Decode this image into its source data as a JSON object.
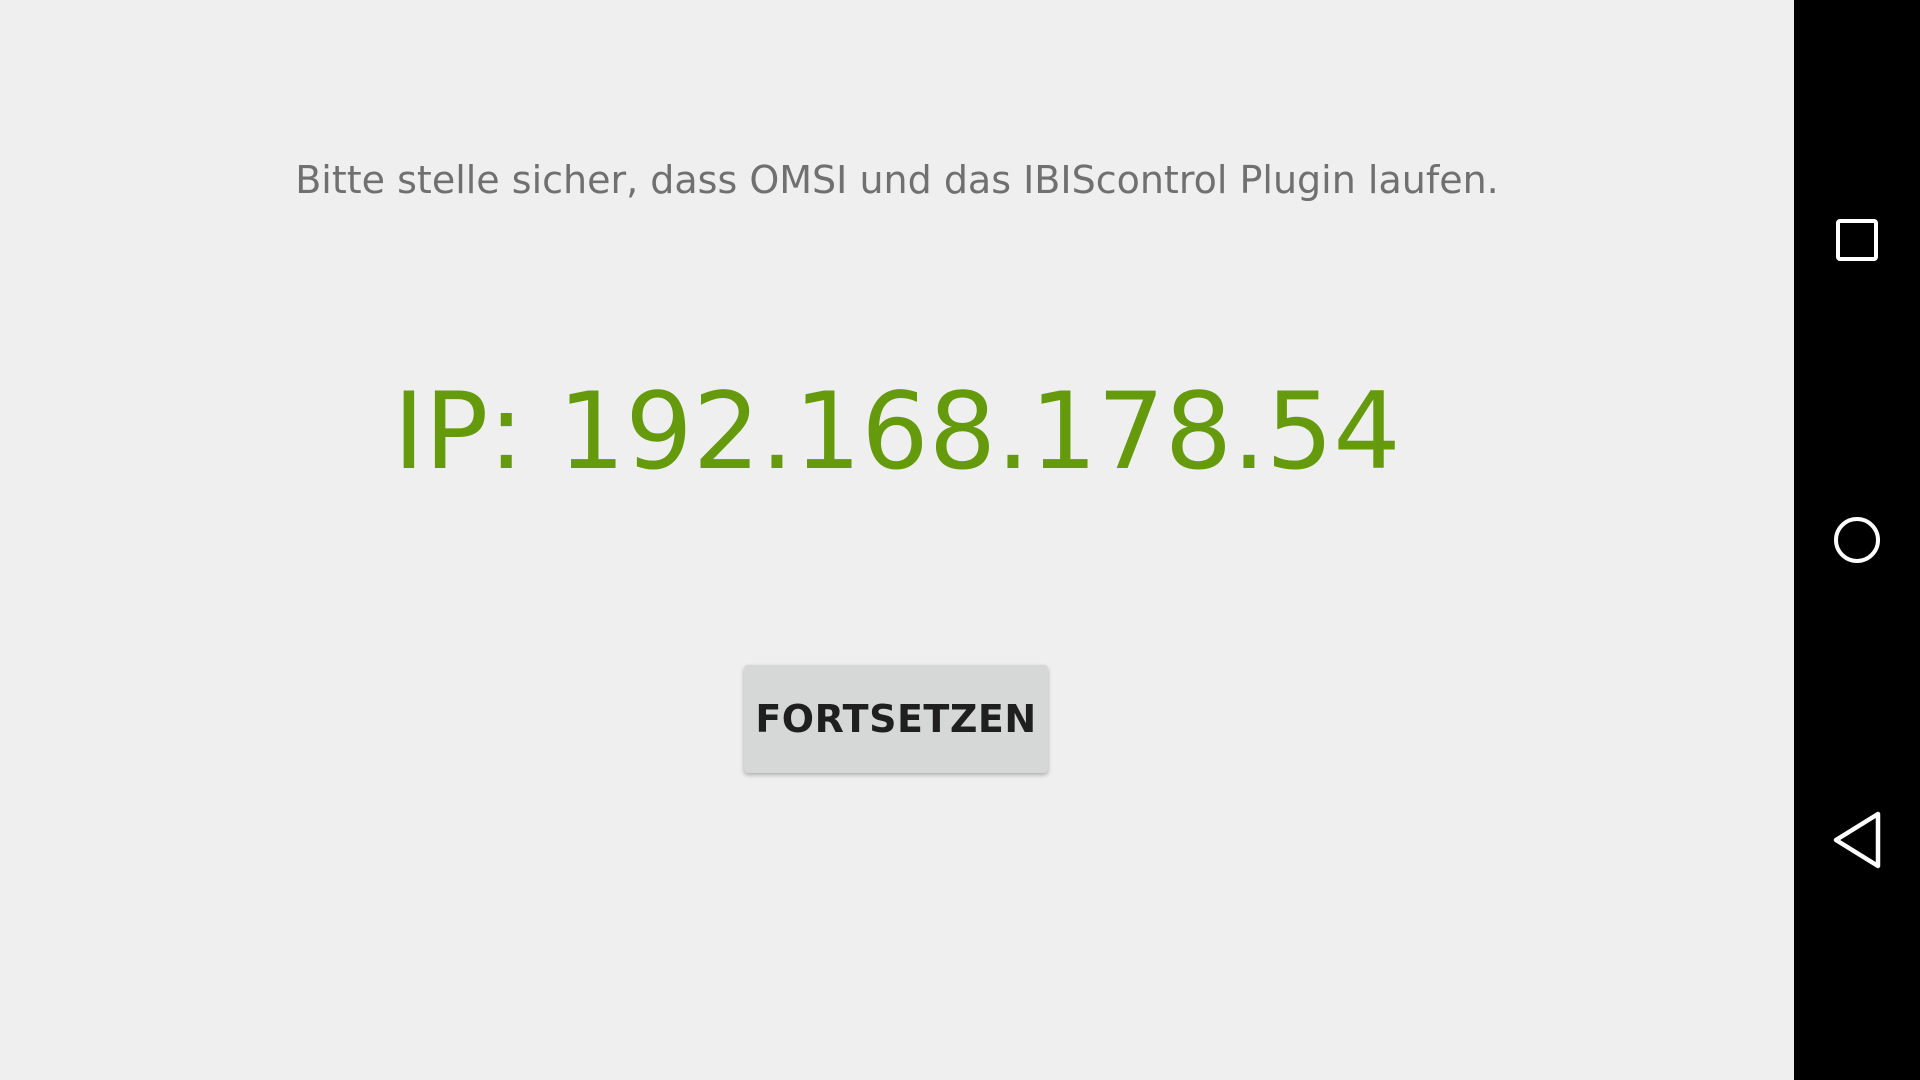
{
  "message": "Bitte stelle sicher, dass OMSI und das IBIScontrol Plugin laufen.",
  "ip_display": "IP: 192.168.178.54",
  "continue_button_label": "FORTSETZEN",
  "nav_bar": {
    "buttons": [
      {
        "icon": "recents-square-icon"
      },
      {
        "icon": "home-circle-icon"
      },
      {
        "icon": "back-triangle-icon"
      }
    ]
  },
  "colors": {
    "background": "#efefef",
    "ip_text": "#649a0b",
    "message_text": "#707070",
    "button_bg": "#d6d7d7",
    "nav_bar_bg": "#000000"
  }
}
